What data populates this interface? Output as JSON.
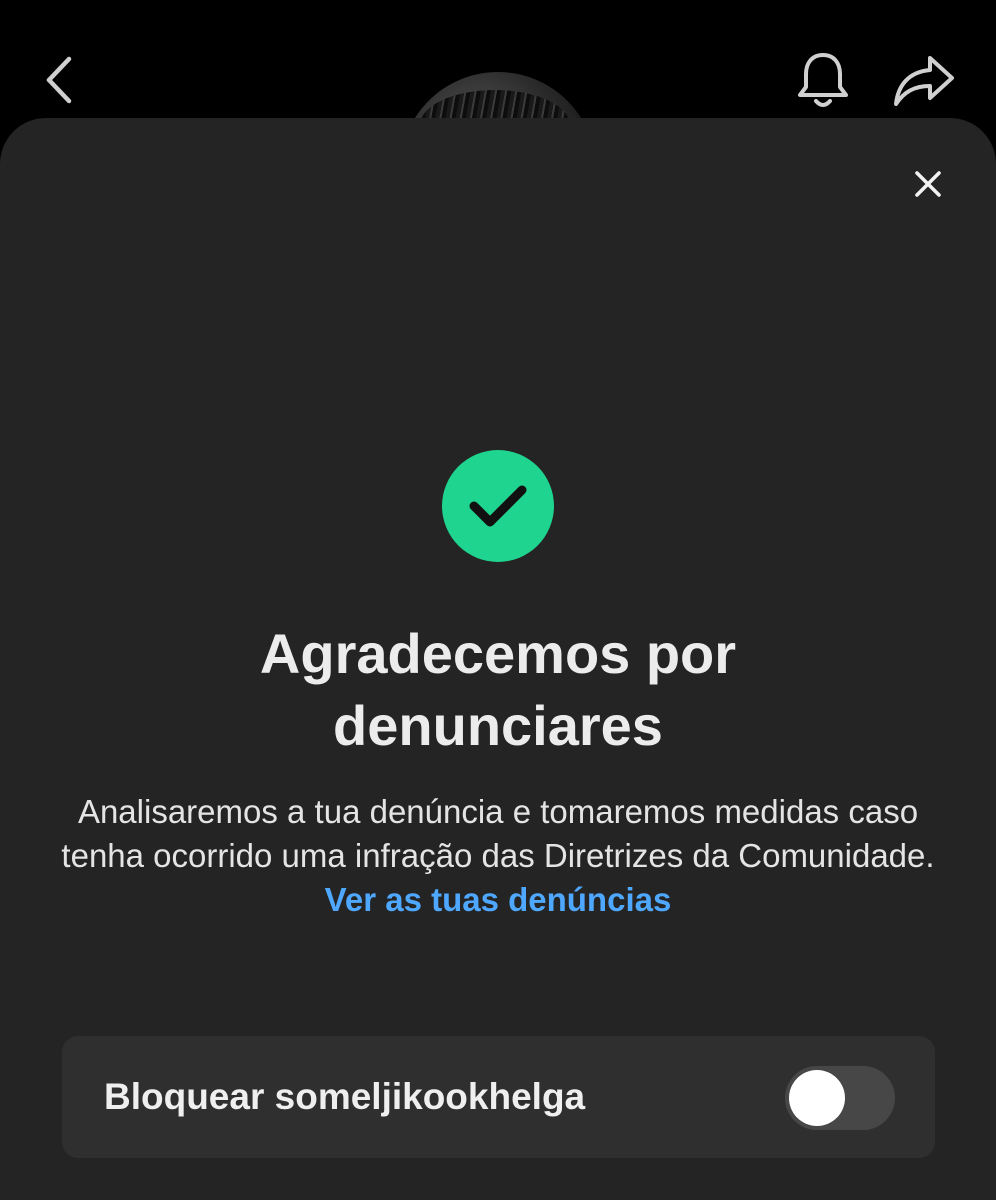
{
  "header": {
    "back_icon": "chevron-left-icon",
    "bell_icon": "bell-icon",
    "share_icon": "share-arrow-icon"
  },
  "sheet": {
    "close_icon": "close-icon",
    "success_icon": "check-circle-icon",
    "title": "Agradecemos por denunciares",
    "description": "Analisaremos a tua denúncia e tomaremos medidas caso tenha ocorrido uma infração das Diretrizes da Comunidade.",
    "link_label": "Ver as tuas denúncias",
    "block_row": {
      "label": "Bloquear someljikookhelga",
      "toggle_on": false
    }
  },
  "colors": {
    "success_green": "#1ed48e",
    "link_blue": "#4fa8ff",
    "sheet_bg": "#242424",
    "row_bg": "#2f2f2f"
  }
}
